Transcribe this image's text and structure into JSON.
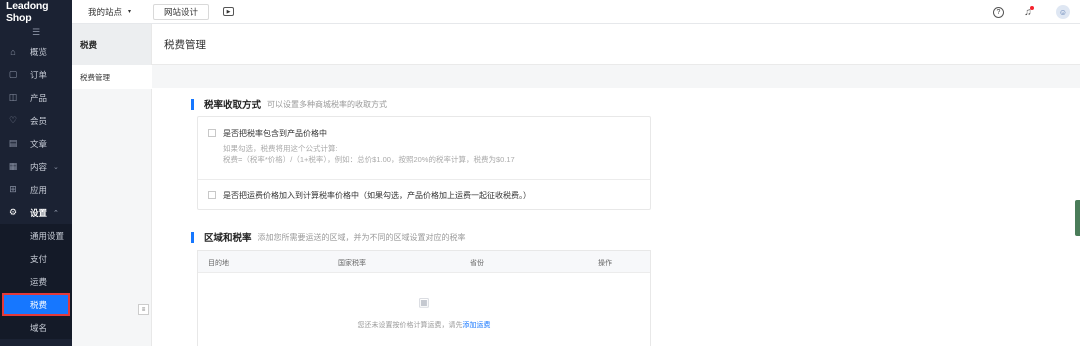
{
  "app": {
    "logo": "Leadong Shop",
    "collapse_icon": "menu-icon"
  },
  "sidebar": {
    "items": [
      {
        "label": "概览",
        "icon": "home-icon",
        "glyph": "⌂"
      },
      {
        "label": "订单",
        "icon": "order-icon",
        "glyph": "▢"
      },
      {
        "label": "产品",
        "icon": "bag-icon",
        "glyph": "◫"
      },
      {
        "label": "会员",
        "icon": "member-icon",
        "glyph": "♡"
      },
      {
        "label": "文章",
        "icon": "article-icon",
        "glyph": "▤"
      },
      {
        "label": "内容",
        "icon": "content-icon",
        "glyph": "▦",
        "chevron": "⌄"
      },
      {
        "label": "应用",
        "icon": "apps-icon",
        "glyph": "⊞"
      },
      {
        "label": "设置",
        "icon": "settings-icon",
        "glyph": "⚙",
        "chevron": "⌃"
      }
    ],
    "settings_sub": [
      {
        "label": "通用设置"
      },
      {
        "label": "支付"
      },
      {
        "label": "运费"
      },
      {
        "label": "税费"
      },
      {
        "label": "域名"
      }
    ]
  },
  "topbar": {
    "site_selector": "我的站点",
    "site_caret": "▾",
    "design_button": "网站设计",
    "play_glyph": "▶",
    "help_glyph": "?",
    "bell_glyph": "🔔"
  },
  "subnav": {
    "title": "税费",
    "items": [
      "税费管理"
    ],
    "toggle_glyph": "≡"
  },
  "main": {
    "title": "税费管理",
    "tax_method": {
      "title": "税率收取方式",
      "desc": "可以设置多种商城税率的收取方式",
      "option1_label": "是否把税率包含到产品价格中",
      "option1_hint1": "如果勾选，税费将用这个公式计算:",
      "option1_hint2": "税费=（税率*价格）/（1+税率），例如：总价$1.00，按照20%的税率计算，税费为$0.17",
      "option2_label": "是否把运费价格加入到计算税率价格中（如果勾选，产品价格加上运费一起征收税费。）"
    },
    "regions": {
      "title": "区域和税率",
      "desc": "添加您所需要运送的区域，并为不同的区域设置对应的税率",
      "columns": [
        "目的地",
        "国家税率",
        "省份",
        "操作"
      ],
      "empty_text": "您还未设置按价格计算运费，请先",
      "empty_link": "添加运费",
      "empty_icon": "empty-box-icon"
    }
  },
  "colors": {
    "sidebar_bg": "#1b2233",
    "accent": "#1677ff",
    "highlight_border": "#e23a3a"
  }
}
